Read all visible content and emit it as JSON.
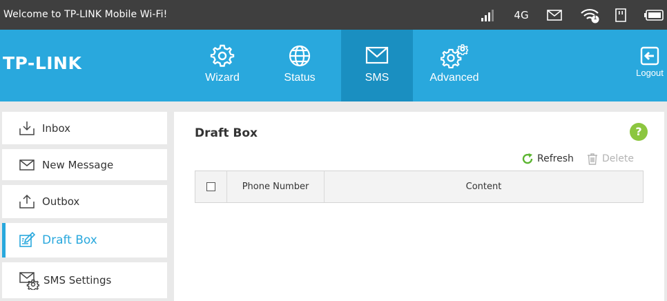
{
  "statusbar": {
    "welcome": "Welcome to TP-LINK Mobile Wi-Fi!",
    "network_type": "4G",
    "wifi_clients": "1",
    "icons": [
      "signal-icon",
      "sms-unread-icon",
      "wifi-icon",
      "sim-icon",
      "battery-icon"
    ]
  },
  "header": {
    "logo": "TP-LINK",
    "tabs": [
      {
        "label": "Wizard",
        "icon": "gear-icon"
      },
      {
        "label": "Status",
        "icon": "globe-icon"
      },
      {
        "label": "SMS",
        "icon": "envelope-icon",
        "active": true
      },
      {
        "label": "Advanced",
        "icon": "gears-icon"
      }
    ],
    "logout": "Logout"
  },
  "sidebar": {
    "items": [
      {
        "label": "Inbox",
        "icon": "inbox-icon"
      },
      {
        "label": "New Message",
        "icon": "new-message-icon"
      },
      {
        "label": "Outbox",
        "icon": "outbox-icon"
      },
      {
        "label": "Draft Box",
        "icon": "draft-icon",
        "active": true
      },
      {
        "label": "SMS Settings",
        "icon": "sms-settings-icon"
      }
    ]
  },
  "main": {
    "title": "Draft Box",
    "help": "?",
    "refresh_label": "Refresh",
    "delete_label": "Delete",
    "table": {
      "columns": [
        "Phone Number",
        "Content"
      ],
      "rows": []
    }
  },
  "colors": {
    "header_bg": "#29a8dd",
    "active_tab_bg": "#1a8fc1",
    "statusbar_bg": "#3f3f3f",
    "help_green": "#8cc63f",
    "refresh_green": "#5cb531"
  }
}
